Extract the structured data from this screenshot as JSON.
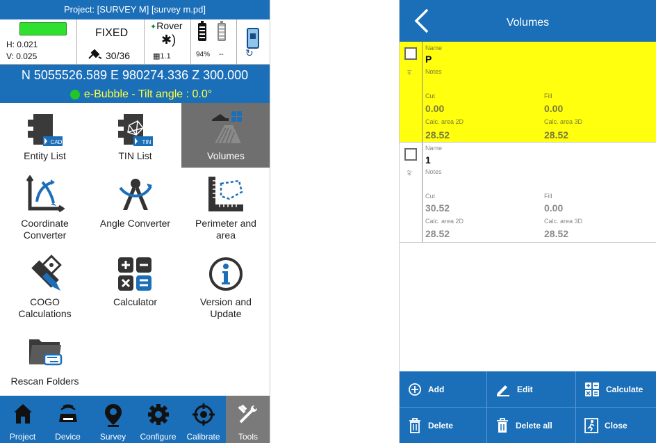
{
  "left": {
    "project_bar": "Project: [SURVEY M] [survey m.pd]",
    "status": {
      "h": "H: 0.021",
      "v": "V: 0.025",
      "fix": "FIXED",
      "sats": "30/36",
      "rover": "Rover",
      "version": "1.1",
      "battery_1": "94%",
      "battery_2": "--"
    },
    "coords": "N 5055526.589   E 980274.336   Z 300.000",
    "bubble": "e-Bubble - Tilt angle : 0.0°",
    "tools": [
      {
        "label": "Entity List"
      },
      {
        "label": "TIN List"
      },
      {
        "label": "Volumes"
      },
      {
        "label_1": "Coordinate",
        "label_2": "Converter"
      },
      {
        "label": "Angle Converter"
      },
      {
        "label_1": "Perimeter and",
        "label_2": "area"
      },
      {
        "label_1": "COGO",
        "label_2": "Calculations"
      },
      {
        "label": "Calculator"
      },
      {
        "label_1": "Version and",
        "label_2": "Update"
      },
      {
        "label": "Rescan Folders"
      }
    ],
    "badges": {
      "cad": "CAD",
      "tin": "TIN"
    },
    "bottom_nav": [
      "Project",
      "Device",
      "Survey",
      "Configure",
      "Calibrate",
      "Tools"
    ],
    "colors": {
      "primary": "#1b6fb9",
      "selected": "#6f6f6f",
      "bubble_text": "#ffff3a"
    }
  },
  "right": {
    "title": "Volumes",
    "field_labels": {
      "name": "Name",
      "notes": "Notes",
      "cut": "Cut",
      "fill": "Fill",
      "area2d": "Calc. area 2D",
      "area3d": "Calc. area 3D"
    },
    "records": [
      {
        "index": "#1",
        "name": "P",
        "cut": "0.00",
        "fill": "0.00",
        "area2d": "28.52",
        "area3d": "28.52",
        "highlight": "#ffff0e"
      },
      {
        "index": "#2",
        "name": "1",
        "cut": "30.52",
        "fill": "0.00",
        "area2d": "28.52",
        "area3d": "28.52"
      }
    ],
    "toolbar": {
      "add": "Add",
      "edit": "Edit",
      "calculate": "Calculate",
      "delete": "Delete",
      "delete_all": "Delete all",
      "close": "Close"
    }
  }
}
